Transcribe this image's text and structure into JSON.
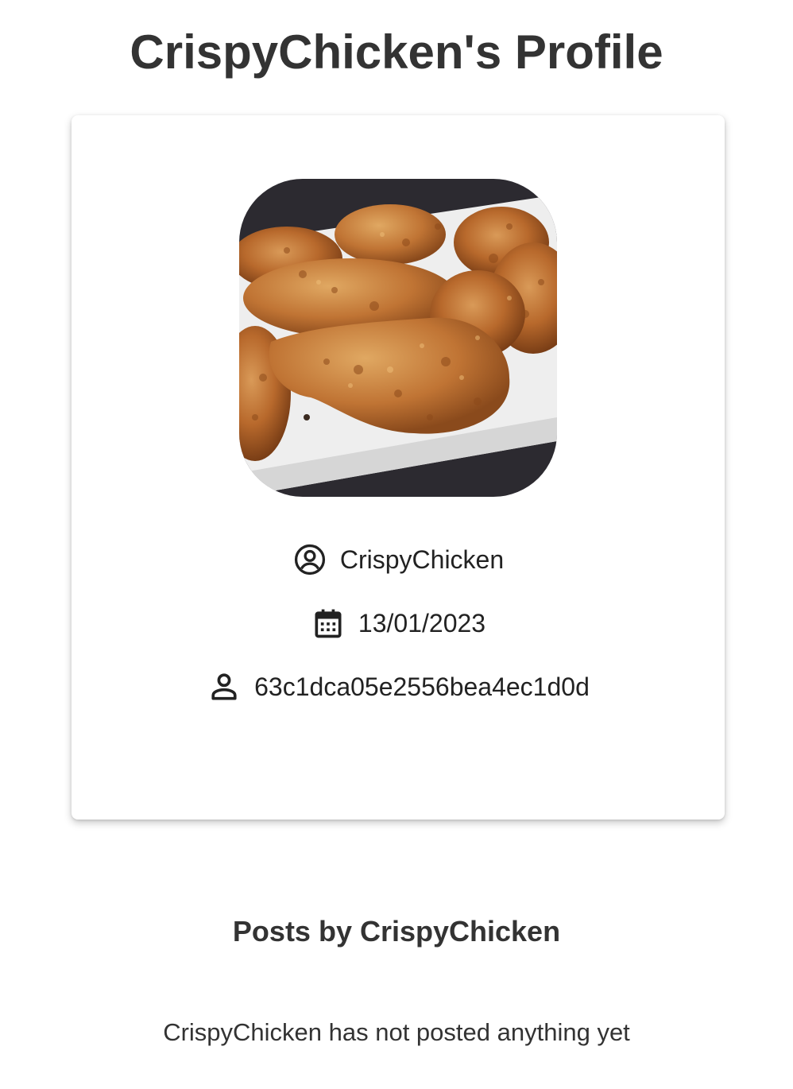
{
  "page": {
    "title": "CrispyChicken's Profile"
  },
  "profile": {
    "avatar_icon": "profile-photo",
    "username": "CrispyChicken",
    "joined_date": "13/01/2023",
    "user_id": "63c1dca05e2556bea4ec1d0d",
    "icons": {
      "username": "account-circle-icon",
      "date": "calendar-icon",
      "id": "person-icon"
    }
  },
  "posts": {
    "heading": "Posts by CrispyChicken",
    "empty_message": "CrispyChicken has not posted anything yet"
  }
}
